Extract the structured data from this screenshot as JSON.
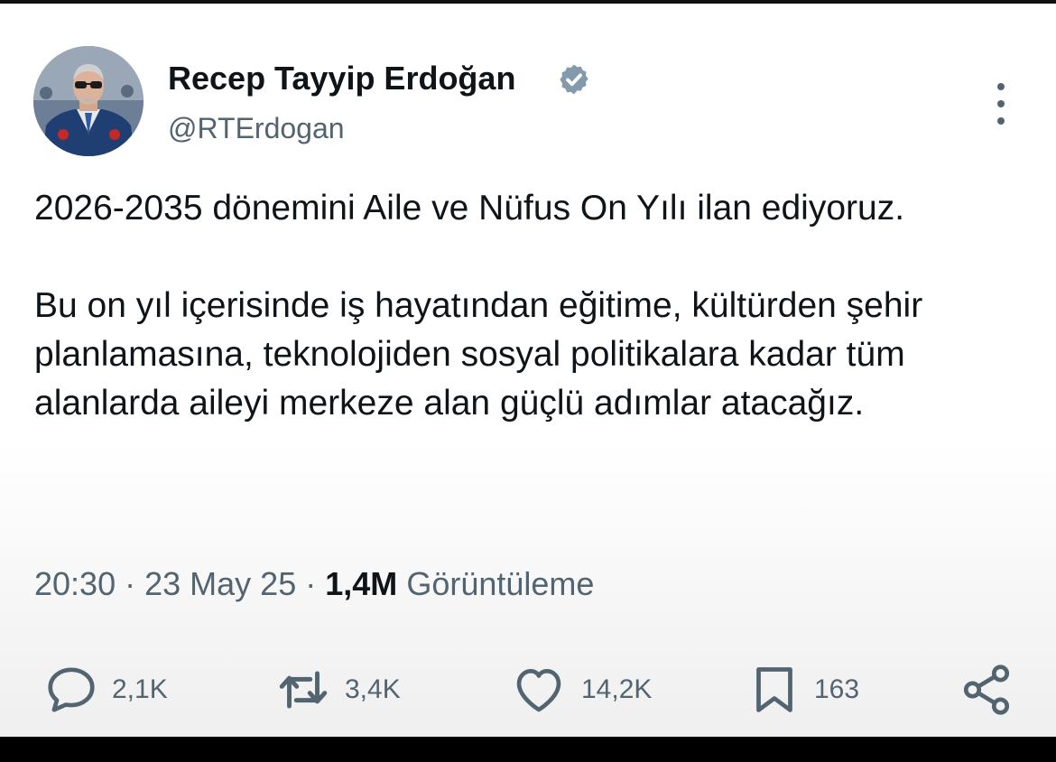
{
  "author": {
    "name": "Recep Tayyip Erdoğan",
    "handle": "@RTErdogan",
    "verified": true
  },
  "tweet": {
    "paragraphs": [
      "2026-2035 dönemini Aile ve Nüfus On Yılı ilan ediyoruz.",
      "Bu on yıl içerisinde iş hayatından eğitime, kültürden şehir planlamasına, teknolojiden sosyal politikalara kadar tüm alanlarda aileyi merkeze alan güçlü adımlar atacağız."
    ]
  },
  "meta": {
    "time": "20:30",
    "separator": "·",
    "date": "23 May 25",
    "views_count": "1,4M",
    "views_label": "Görüntüleme"
  },
  "actions": {
    "replies": "2,1K",
    "reposts": "3,4K",
    "likes": "14,2K",
    "bookmarks": "163"
  },
  "colors": {
    "text": "#0f1419",
    "secondary": "#536471",
    "verified_badge": "#829aab"
  }
}
